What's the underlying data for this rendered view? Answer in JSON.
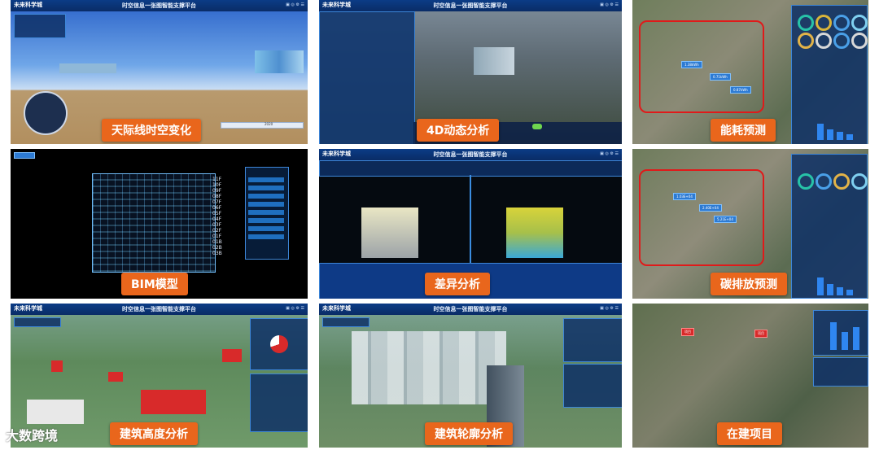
{
  "platform": {
    "logo": "未来科学城",
    "title": "时空信息一张图智能支撑平台"
  },
  "tiles": [
    {
      "label": "天际线时空变化",
      "year": "2020"
    },
    {
      "label": "4D动态分析"
    },
    {
      "label": "能耗预测"
    },
    {
      "label": "BIM模型",
      "floors": [
        "11F",
        "10F",
        "09F",
        "08F",
        "07F",
        "06F",
        "05F",
        "04F",
        "03F",
        "02F",
        "01F",
        "01B",
        "02B",
        "03B"
      ]
    },
    {
      "label": "差异分析"
    },
    {
      "label": "碳排放预测"
    },
    {
      "label": "建筑高度分析"
    },
    {
      "label": "建筑轮廓分析"
    },
    {
      "label": "在建项目"
    }
  ],
  "watermark": "大数跨境",
  "colors": {
    "badge": "#e9661c",
    "header": "#0b3c86",
    "highlight": "#e01a1a"
  }
}
